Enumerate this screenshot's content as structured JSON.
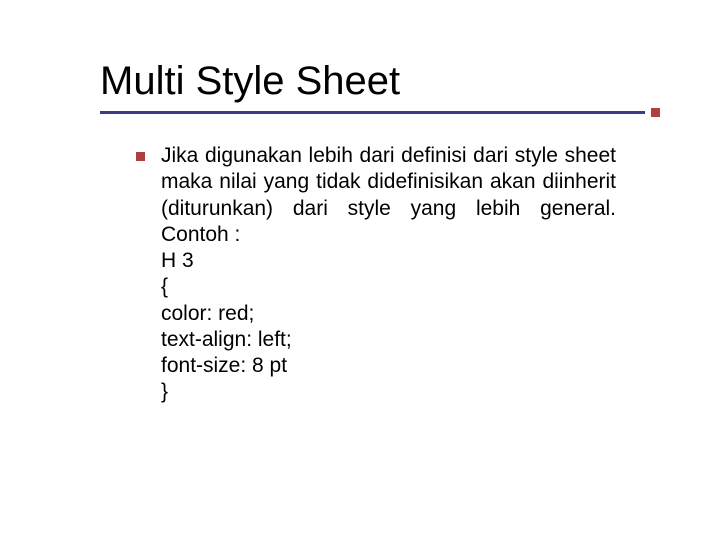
{
  "title": "Multi Style Sheet",
  "paragraph": "Jika digunakan lebih dari definisi dari style sheet maka nilai yang tidak didefinisikan akan diinherit (diturunkan) dari style yang lebih general. Contoh :",
  "code": {
    "l1": "H 3",
    "l2": "{",
    "l3": "color: red;",
    "l4": "text-align: left;",
    "l5": "font-size: 8 pt",
    "l6": "}"
  }
}
